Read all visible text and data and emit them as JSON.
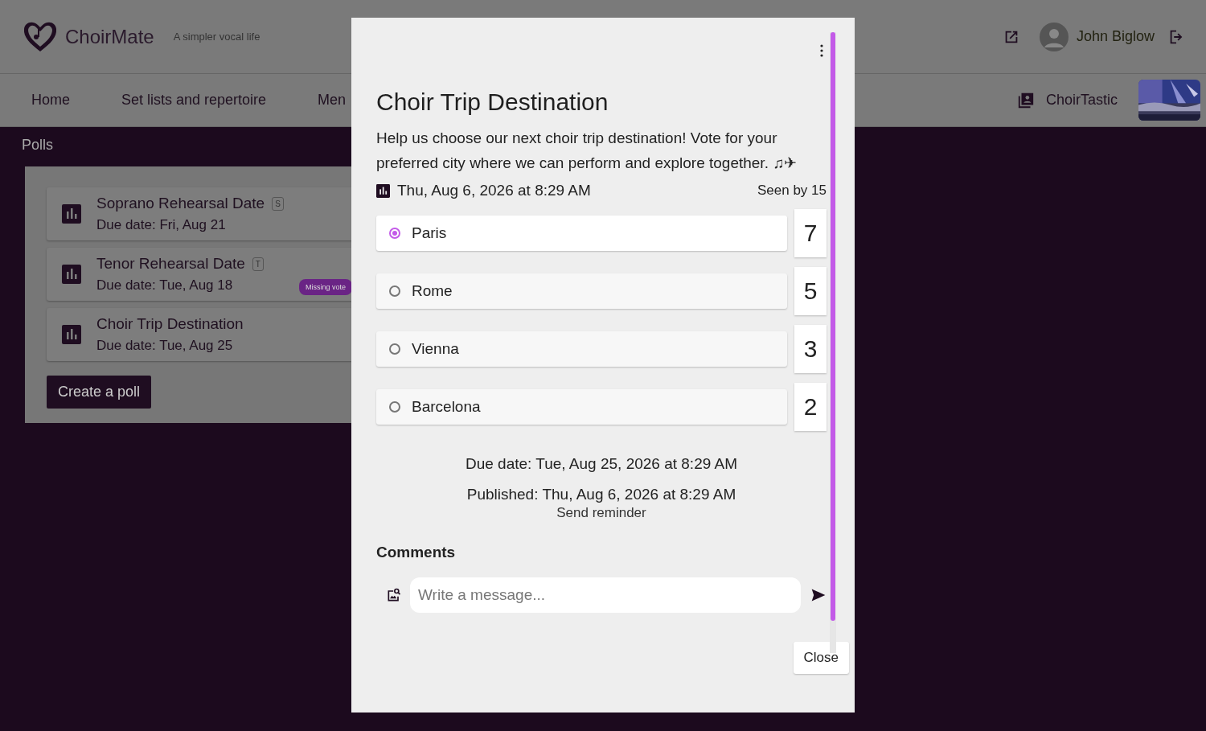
{
  "header": {
    "brand": "ChoirMate",
    "tagline": "A simpler vocal life",
    "user": "John Biglow"
  },
  "nav": {
    "items": [
      {
        "label": "Home"
      },
      {
        "label": "Set lists and repertoire"
      },
      {
        "label": "Men"
      }
    ],
    "choir": "ChoirTastic"
  },
  "page": {
    "title": "Polls",
    "create_button": "Create a poll",
    "polls": [
      {
        "title": "Soprano Rehearsal Date",
        "tag": "S",
        "due": "Due date: Fri, Aug 21",
        "missing_vote": false
      },
      {
        "title": "Tenor Rehearsal Date",
        "tag": "T",
        "due": "Due date: Tue, Aug 18",
        "missing_vote": true,
        "badge": "Missing vote"
      },
      {
        "title": "Choir Trip Destination",
        "due": "Due date: Tue, Aug 25",
        "missing_vote": false
      }
    ]
  },
  "dialog": {
    "title": "Choir Trip Destination",
    "description": "Help us choose our next choir trip destination! Vote for your preferred city where we can perform and explore together. ♫✈",
    "date": "Thu, Aug 6, 2026 at 8:29 AM",
    "seen_by": "Seen by 15",
    "options": [
      {
        "label": "Paris",
        "votes": "7",
        "selected": true
      },
      {
        "label": "Rome",
        "votes": "5",
        "selected": false
      },
      {
        "label": "Vienna",
        "votes": "3",
        "selected": false
      },
      {
        "label": "Barcelona",
        "votes": "2",
        "selected": false
      }
    ],
    "due": "Due date: Tue, Aug 25, 2026 at 8:29 AM",
    "published": "Published: Thu, Aug 6, 2026 at 8:29 AM",
    "reminder": "Send reminder",
    "comments_title": "Comments",
    "message_placeholder": "Write a message...",
    "close": "Close"
  }
}
